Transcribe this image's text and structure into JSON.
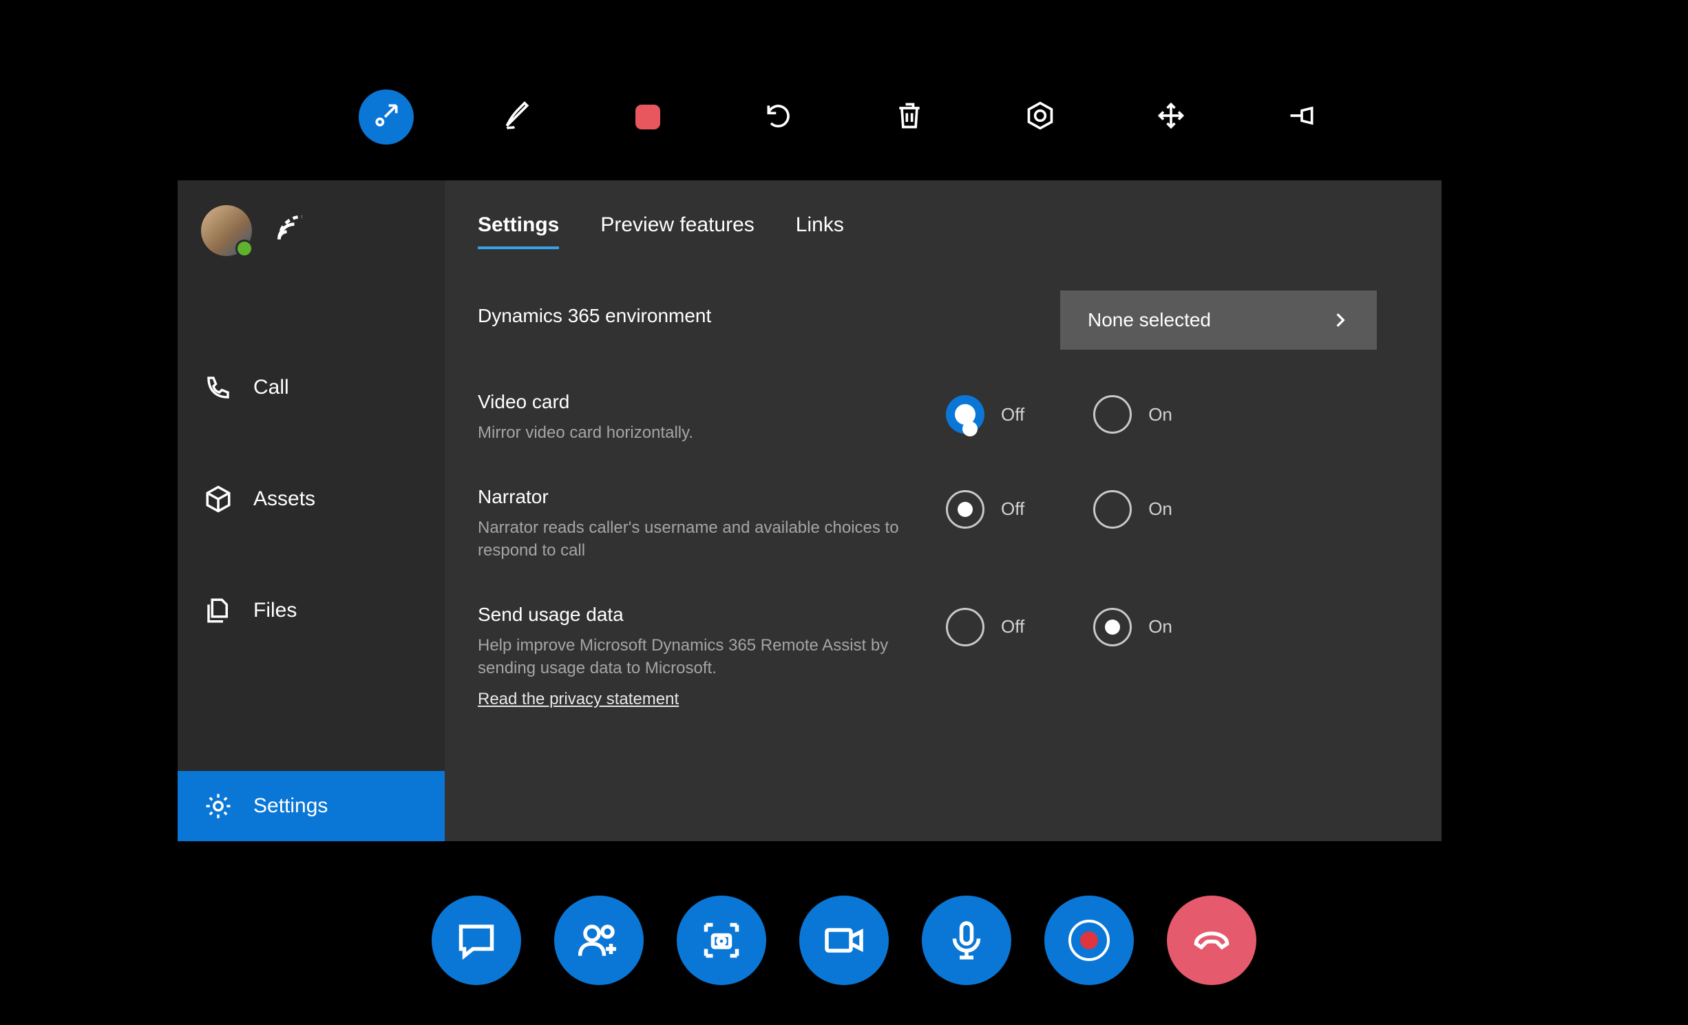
{
  "toolbar_top": {
    "items": [
      "collapse",
      "ink",
      "stop",
      "undo",
      "delete",
      "target",
      "move",
      "pin"
    ]
  },
  "sidebar": {
    "items": [
      {
        "id": "call",
        "label": "Call"
      },
      {
        "id": "assets",
        "label": "Assets"
      },
      {
        "id": "files",
        "label": "Files"
      },
      {
        "id": "settings",
        "label": "Settings"
      }
    ],
    "selected": "settings"
  },
  "tabs": {
    "items": [
      "Settings",
      "Preview features",
      "Links"
    ],
    "active": 0
  },
  "settings": {
    "env": {
      "title": "Dynamics 365 environment",
      "value": "None selected"
    },
    "video": {
      "title": "Video card",
      "desc": "Mirror video card horizontally.",
      "off": "Off",
      "on": "On",
      "value": "Off",
      "focused": true
    },
    "narrator": {
      "title": "Narrator",
      "desc": "Narrator reads caller's username and available choices to respond to call",
      "off": "Off",
      "on": "On",
      "value": "Off"
    },
    "usage": {
      "title": "Send usage data",
      "desc": "Help improve Microsoft Dynamics 365 Remote Assist by sending usage data to Microsoft.",
      "link": "Read the privacy statement",
      "off": "Off",
      "on": "On",
      "value": "On"
    }
  },
  "callbar": {
    "items": [
      "chat",
      "add-people",
      "capture",
      "video",
      "mic",
      "record",
      "end-call"
    ]
  }
}
